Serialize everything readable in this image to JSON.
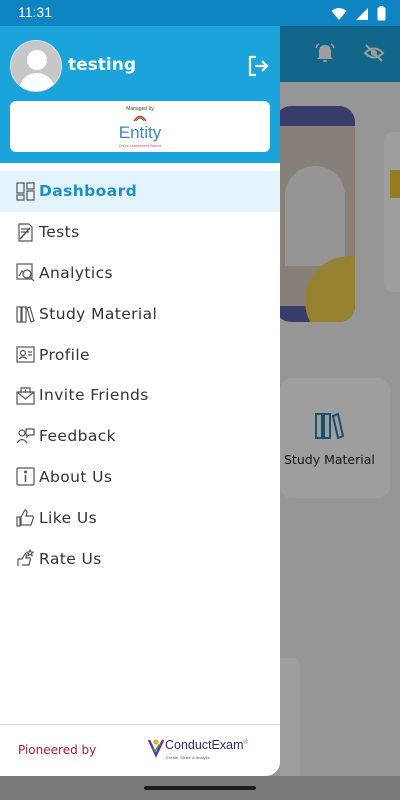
{
  "status_bar": {
    "time": "11:31"
  },
  "drawer": {
    "username": "testing",
    "org": {
      "managed_by": "Managed by",
      "name": "Entity",
      "tagline": "Online Assessment Partner"
    },
    "menu": [
      {
        "label": "Dashboard",
        "icon": "dashboard-icon",
        "active": true
      },
      {
        "label": "Tests",
        "icon": "tests-icon",
        "active": false
      },
      {
        "label": "Analytics",
        "icon": "analytics-icon",
        "active": false
      },
      {
        "label": "Study Material",
        "icon": "study-material-icon",
        "active": false
      },
      {
        "label": "Profile",
        "icon": "profile-icon",
        "active": false
      },
      {
        "label": "Invite Friends",
        "icon": "invite-friends-icon",
        "active": false
      },
      {
        "label": "Feedback",
        "icon": "feedback-icon",
        "active": false
      },
      {
        "label": "About Us",
        "icon": "about-us-icon",
        "active": false
      },
      {
        "label": "Like Us",
        "icon": "like-us-icon",
        "active": false
      },
      {
        "label": "Rate Us",
        "icon": "rate-us-icon",
        "active": false
      }
    ],
    "footer": {
      "pioneered_by": "Pioneered by",
      "brand": "ConductExam",
      "brand_mark": "®",
      "brand_tagline": "Create, Share & Analyze"
    }
  },
  "background": {
    "card_label": "Study Material"
  },
  "colors": {
    "primary": "#1ba3dc",
    "status_bar": "#0e84c2",
    "active_bg": "#e3f4fc",
    "active_text": "#1b8fc7",
    "pioneered_text": "#b2182b"
  }
}
